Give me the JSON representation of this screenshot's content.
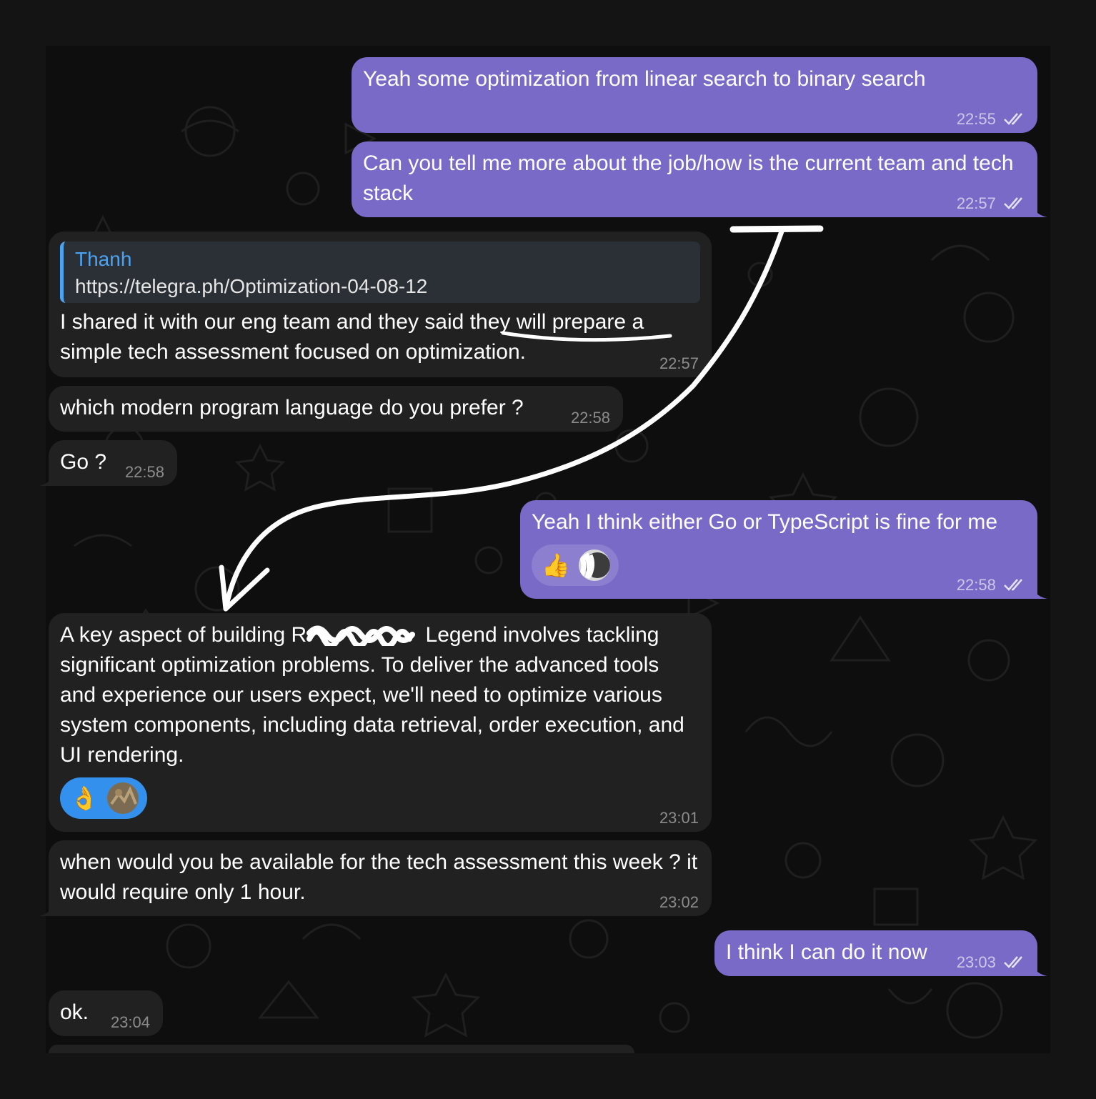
{
  "colors": {
    "page_bg": "#141414",
    "chat_bg": "#0e0e0e",
    "outgoing_bubble": "#7a6ac8",
    "incoming_bubble": "#212121",
    "reply_accent": "#4ea3f0",
    "reaction_incoming": "#3390ec",
    "annotation_stroke": "#ffffff"
  },
  "messages": [
    {
      "direction": "outgoing",
      "text": "Yeah some optimization from linear search to binary search",
      "time": "22:55",
      "status_icon": "double-check-icon"
    },
    {
      "direction": "outgoing",
      "text": "Can you tell me more about the job/how is the current team and tech stack",
      "time": "22:57",
      "status_icon": "double-check-icon"
    },
    {
      "direction": "incoming",
      "reply": {
        "name": "Thanh",
        "text": "https://telegra.ph/Optimization-04-08-12"
      },
      "text_before": "I shared it  with our eng  team and they said ",
      "text_underlined": "they will prepare",
      "text_after": " a simple tech assessment focused on optimization.",
      "time": "22:57"
    },
    {
      "direction": "incoming",
      "text": "which modern program language do you prefer ?",
      "time": "22:58"
    },
    {
      "direction": "incoming",
      "text": "Go ?",
      "time": "22:58"
    },
    {
      "direction": "outgoing",
      "text": "Yeah I think either Go or TypeScript is fine for me",
      "time": "22:58",
      "status_icon": "double-check-icon",
      "reaction": {
        "emoji": "👍",
        "icon": "thumbs-up-icon"
      }
    },
    {
      "direction": "incoming",
      "text_before": "A key aspect of building R",
      "text_after": " Legend involves tackling significant optimization problems. To deliver the advanced tools and experience our users expect, we'll need to optimize various system components, including data retrieval, order execution, and UI rendering.",
      "time": "23:01",
      "reaction": {
        "emoji": "👌",
        "icon": "ok-hand-icon"
      }
    },
    {
      "direction": "incoming",
      "text": "when would you be available for the tech assessment this week ? it would require only 1 hour.",
      "time": "23:02"
    },
    {
      "direction": "outgoing",
      "text": "I think I can do it now",
      "time": "23:03",
      "status_icon": "double-check-icon"
    },
    {
      "direction": "incoming",
      "text": "ok.",
      "time": "23:04"
    }
  ]
}
